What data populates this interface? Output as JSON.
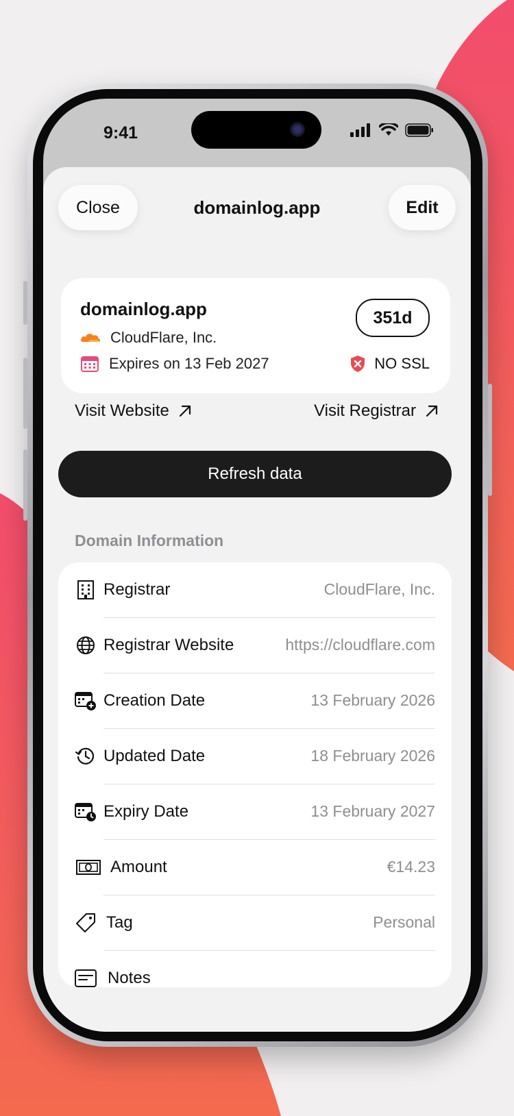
{
  "colors": {
    "accent_pink": "#f24d6c",
    "accent_orange": "#f36a4f",
    "ssl_red": "#e94a56",
    "cloudflare_orange": "#f6821f"
  },
  "status_bar": {
    "time": "9:41"
  },
  "nav": {
    "close_label": "Close",
    "title": "domainlog.app",
    "edit_label": "Edit"
  },
  "card": {
    "domain": "domainlog.app",
    "registrar": "CloudFlare, Inc.",
    "expires": "Expires on 13 Feb 2027",
    "days_left": "351d",
    "ssl_status": "NO SSL",
    "registrar_icon": "cloud-icon",
    "calendar_icon": "calendar-icon",
    "ssl_icon": "shield-x-icon"
  },
  "links": {
    "visit_website": "Visit Website",
    "visit_registrar": "Visit Registrar"
  },
  "refresh_label": "Refresh data",
  "section_title": "Domain Information",
  "info_rows": [
    {
      "icon": "building-icon",
      "label": "Registrar",
      "value": "CloudFlare, Inc."
    },
    {
      "icon": "globe-icon",
      "label": "Registrar Website",
      "value": "https://cloudflare.com"
    },
    {
      "icon": "calendar-plus-icon",
      "label": "Creation Date",
      "value": "13 February 2026"
    },
    {
      "icon": "clock-refresh-icon",
      "label": "Updated Date",
      "value": "18 February 2026"
    },
    {
      "icon": "calendar-clock-icon",
      "label": "Expiry Date",
      "value": "13 February 2027"
    },
    {
      "icon": "banknote-icon",
      "label": "Amount",
      "value": "€14.23"
    },
    {
      "icon": "tag-icon",
      "label": "Tag",
      "value": "Personal"
    },
    {
      "icon": "notes-icon",
      "label": "Notes",
      "value": ""
    }
  ]
}
